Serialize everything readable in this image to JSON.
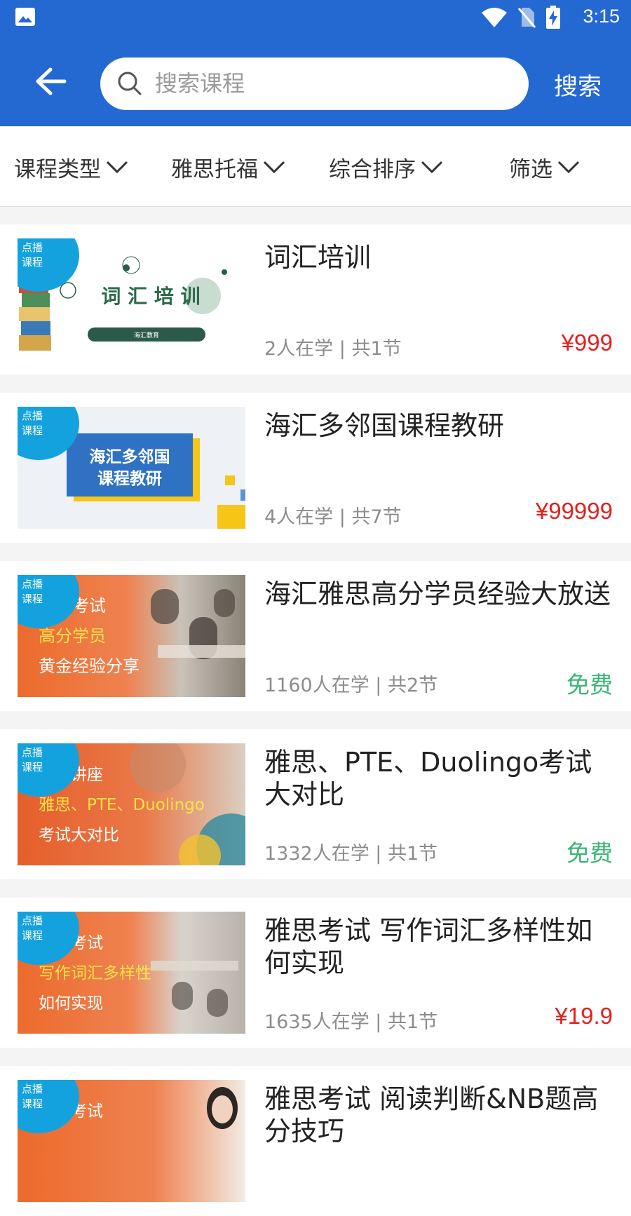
{
  "status_bar": {
    "time": "3:15"
  },
  "header": {
    "search_placeholder": "搜索课程",
    "search_button": "搜索"
  },
  "filters": [
    {
      "label": "课程类型"
    },
    {
      "label": "雅思托福"
    },
    {
      "label": "综合排序"
    },
    {
      "label": "筛选"
    }
  ],
  "badge_label": "点播课程",
  "courses": [
    {
      "title": "词汇培训",
      "meta": "2人在学 | 共1节",
      "price": "¥999",
      "thumb": {
        "text1": "词 汇 培 训",
        "text2": "海汇教育"
      }
    },
    {
      "title": "海汇多邻国课程教研",
      "meta": "4人在学 | 共7节",
      "price": "¥99999",
      "thumb": {
        "text1": "海汇多邻国",
        "text2": "课程教研"
      }
    },
    {
      "title": "海汇雅思高分学员经验大放送",
      "meta": "1160人在学 | 共2节",
      "price": "免费",
      "thumb": {
        "text1": "雅思考试",
        "text2": "高分学员",
        "text3": "黄金经验分享"
      }
    },
    {
      "title": "雅思、PTE、Duolingo考试大对比",
      "meta": "1332人在学 | 共1节",
      "price": "免费",
      "thumb": {
        "text1": "公益讲座",
        "text2": "雅思、PTE、Duolingo",
        "text3": "考试大对比"
      }
    },
    {
      "title": "雅思考试 写作词汇多样性如何实现",
      "meta": "1635人在学 | 共1节",
      "price": "¥19.9",
      "thumb": {
        "text1": "雅思考试",
        "text2": "写作词汇多样性",
        "text3": "如何实现"
      }
    },
    {
      "title": "雅思考试 阅读判断&NB题高分技巧",
      "thumb": {
        "text1": "雅思考试"
      }
    }
  ],
  "colors": {
    "primary": "#2468d2",
    "price_red": "#e51f1f",
    "free_green": "#3bb574",
    "badge_blue": "#14a2de"
  }
}
